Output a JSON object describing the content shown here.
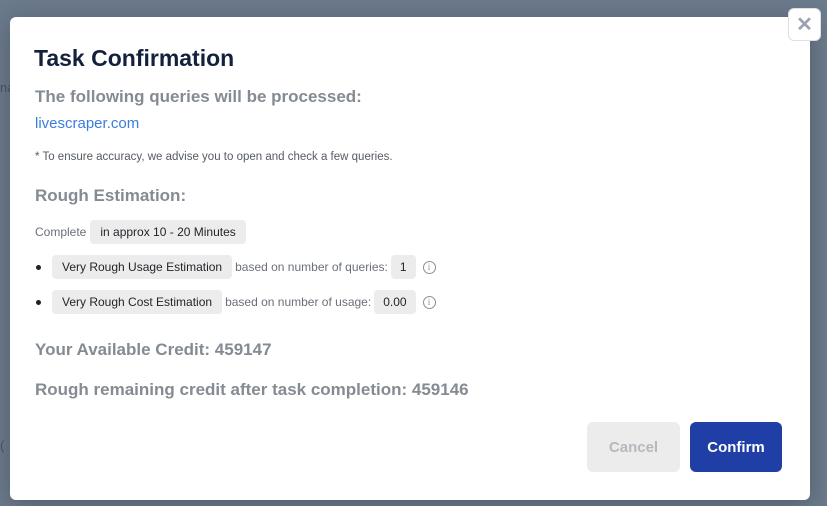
{
  "dialog": {
    "title": "Task Confirmation",
    "queries_heading": "The following queries will be processed:",
    "query_link": "livescraper.com",
    "accuracy_note": "* To ensure accuracy, we advise you to open and check a few queries.",
    "rough_heading": "Rough Estimation:",
    "complete_label": "Complete",
    "complete_time": "in approx 10 - 20 Minutes",
    "usage": {
      "label": "Very Rough Usage Estimation",
      "basis": "based on number of queries:",
      "value": "1"
    },
    "cost": {
      "label": "Very Rough Cost Estimation",
      "basis": "based on number of usage:",
      "value": "0.00"
    },
    "available_credit": "Your Available Credit: 459147",
    "remaining_credit": "Rough remaining credit after task completion: 459146",
    "cancel_label": "Cancel",
    "confirm_label": "Confirm",
    "close_glyph": "✕",
    "info_glyph": "i"
  },
  "icons": {
    "close": "close-icon",
    "info": "info-icon"
  },
  "colors": {
    "backdrop": "#6b7a8c",
    "title": "#14213d",
    "link": "#3b7ddd",
    "confirm_bg": "#1f3fa6",
    "cancel_bg": "#ececec"
  }
}
